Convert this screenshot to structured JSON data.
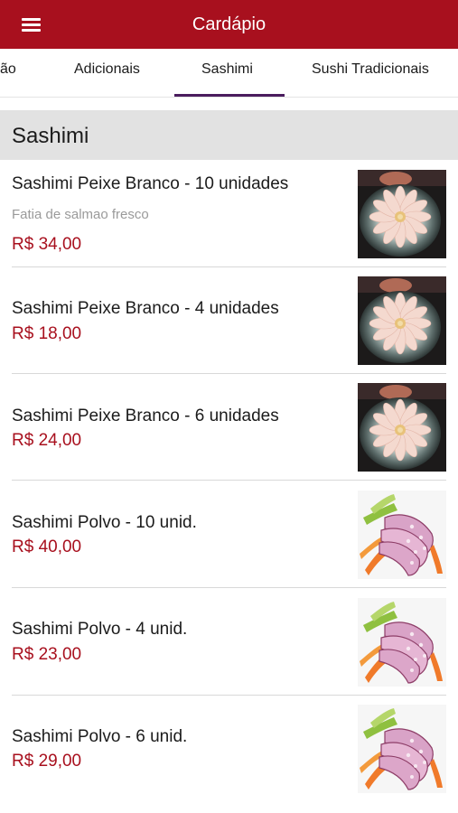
{
  "appbar": {
    "title": "Cardápio",
    "menu_icon": "hamburger-menu-icon"
  },
  "tabs": [
    {
      "label": "ão"
    },
    {
      "label": "Adicionais"
    },
    {
      "label": "Sashimi",
      "selected": true
    },
    {
      "label": "Sushi Tradicionais"
    }
  ],
  "colors": {
    "brand": "#a8101e",
    "tab_indicator": "#4a1c5e",
    "section_bg": "#e2e2e2",
    "price": "#a8101e"
  },
  "section": {
    "title": "Sashimi"
  },
  "items": [
    {
      "name": "Sashimi Peixe Branco - 10 unidades",
      "description": "Fatia de salmao fresco",
      "price": "R$ 34,00",
      "image": "white-fish-sashimi-photo"
    },
    {
      "name": "Sashimi Peixe Branco - 4 unidades",
      "price": "R$ 18,00",
      "image": "white-fish-sashimi-photo"
    },
    {
      "name": "Sashimi Peixe Branco - 6 unidades",
      "price": "R$ 24,00",
      "image": "white-fish-sashimi-photo"
    },
    {
      "name": "Sashimi Polvo - 10 unid.",
      "price": "R$ 40,00",
      "image": "octopus-sashimi-photo"
    },
    {
      "name": "Sashimi Polvo - 4 unid.",
      "price": "R$ 23,00",
      "image": "octopus-sashimi-photo"
    },
    {
      "name": "Sashimi Polvo - 6 unid.",
      "price": "R$ 29,00",
      "image": "octopus-sashimi-photo"
    }
  ]
}
